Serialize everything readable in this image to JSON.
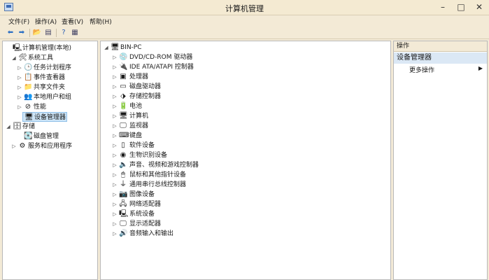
{
  "window": {
    "title": "计算机管理"
  },
  "menu": [
    "文件(F)",
    "操作(A)",
    "查看(V)",
    "帮助(H)"
  ],
  "left_tree": [
    {
      "label": "计算机管理(本地)",
      "icon": "computer-management-icon",
      "glyph": "🖳",
      "arrow": ""
    },
    {
      "label": "系统工具",
      "icon": "system-tools-icon",
      "glyph": "🛠",
      "arrow": "◢"
    },
    {
      "label": "任务计划程序",
      "icon": "task-scheduler-icon",
      "glyph": "🕒",
      "arrow": "▷"
    },
    {
      "label": "事件查看器",
      "icon": "event-viewer-icon",
      "glyph": "📋",
      "arrow": "▷"
    },
    {
      "label": "共享文件夹",
      "icon": "shared-folders-icon",
      "glyph": "📁",
      "arrow": "▷"
    },
    {
      "label": "本地用户和组",
      "icon": "local-users-icon",
      "glyph": "👥",
      "arrow": "▷"
    },
    {
      "label": "性能",
      "icon": "performance-icon",
      "glyph": "⊘",
      "arrow": "▷"
    },
    {
      "label": "设备管理器",
      "icon": "device-manager-icon",
      "glyph": "🖥",
      "arrow": ""
    },
    {
      "label": "存储",
      "icon": "storage-icon",
      "glyph": "🗄",
      "arrow": "◢"
    },
    {
      "label": "磁盘管理",
      "icon": "disk-management-icon",
      "glyph": "💽",
      "arrow": ""
    },
    {
      "label": "服务和应用程序",
      "icon": "services-apps-icon",
      "glyph": "⚙",
      "arrow": "▷"
    }
  ],
  "device_tree": {
    "root": {
      "label": "BIN-PC",
      "icon": "pc-icon",
      "glyph": "🖥",
      "arrow": "◢"
    },
    "items": [
      {
        "label": "DVD/CD-ROM 驱动器",
        "icon": "dvd-drive-icon",
        "glyph": "💿"
      },
      {
        "label": "IDE ATA/ATAPI 控制器",
        "icon": "ide-controller-icon",
        "glyph": "🔌"
      },
      {
        "label": "处理器",
        "icon": "processor-icon",
        "glyph": "▣"
      },
      {
        "label": "磁盘驱动器",
        "icon": "disk-drive-icon",
        "glyph": "▭"
      },
      {
        "label": "存储控制器",
        "icon": "storage-controller-icon",
        "glyph": "⬗"
      },
      {
        "label": "电池",
        "icon": "battery-icon",
        "glyph": "🔋"
      },
      {
        "label": "计算机",
        "icon": "computer-icon",
        "glyph": "🖥"
      },
      {
        "label": "监视器",
        "icon": "monitor-icon",
        "glyph": "🖵"
      },
      {
        "label": "键盘",
        "icon": "keyboard-icon",
        "glyph": "⌨"
      },
      {
        "label": "软件设备",
        "icon": "software-device-icon",
        "glyph": "▯"
      },
      {
        "label": "生物识别设备",
        "icon": "biometric-icon",
        "glyph": "◉"
      },
      {
        "label": "声音、视频和游戏控制器",
        "icon": "sound-icon",
        "glyph": "🔈"
      },
      {
        "label": "鼠标和其他指针设备",
        "icon": "mouse-icon",
        "glyph": "🖱"
      },
      {
        "label": "通用串行总线控制器",
        "icon": "usb-icon",
        "glyph": "⏚"
      },
      {
        "label": "图像设备",
        "icon": "imaging-icon",
        "glyph": "📷"
      },
      {
        "label": "网络适配器",
        "icon": "network-adapter-icon",
        "glyph": "🖧"
      },
      {
        "label": "系统设备",
        "icon": "system-device-icon",
        "glyph": "🖳"
      },
      {
        "label": "显示适配器",
        "icon": "display-adapter-icon",
        "glyph": "🖵"
      },
      {
        "label": "音频输入和输出",
        "icon": "audio-io-icon",
        "glyph": "🔊"
      }
    ]
  },
  "actions": {
    "header": "操作",
    "section": "设备管理器",
    "item": "更多操作"
  }
}
